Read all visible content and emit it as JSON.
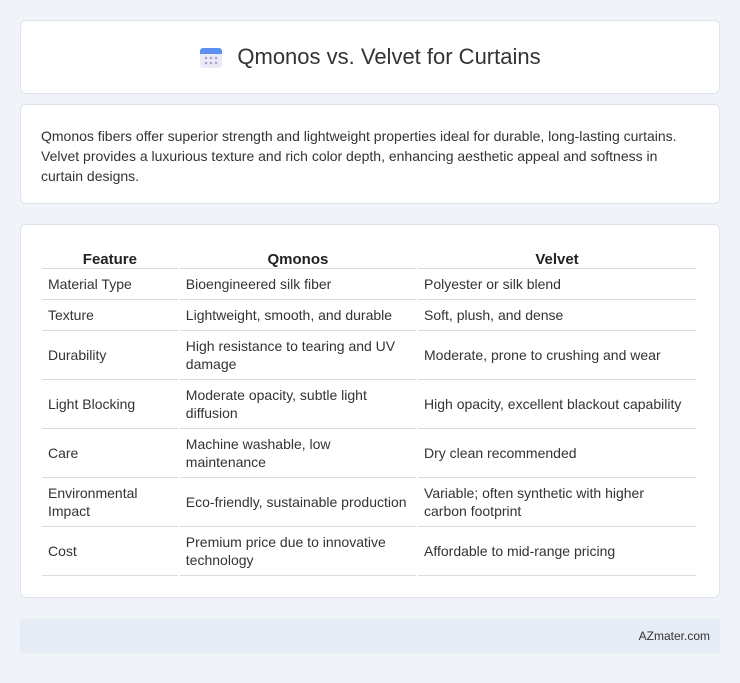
{
  "header": {
    "title": "Qmonos vs. Velvet for Curtains",
    "icon": "calendar-icon"
  },
  "intro": {
    "text": "Qmonos fibers offer superior strength and lightweight properties ideal for durable, long-lasting curtains. Velvet provides a luxurious texture and rich color depth, enhancing aesthetic appeal and softness in curtain designs."
  },
  "table": {
    "headers": [
      "Feature",
      "Qmonos",
      "Velvet"
    ],
    "rows": [
      [
        "Material Type",
        "Bioengineered silk fiber",
        "Polyester or silk blend"
      ],
      [
        "Texture",
        "Lightweight, smooth, and durable",
        "Soft, plush, and dense"
      ],
      [
        "Durability",
        "High resistance to tearing and UV damage",
        "Moderate, prone to crushing and wear"
      ],
      [
        "Light Blocking",
        "Moderate opacity, subtle light diffusion",
        "High opacity, excellent blackout capability"
      ],
      [
        "Care",
        "Machine washable, low maintenance",
        "Dry clean recommended"
      ],
      [
        "Environmental Impact",
        "Eco-friendly, sustainable production",
        "Variable; often synthetic with higher carbon footprint"
      ],
      [
        "Cost",
        "Premium price due to innovative technology",
        "Affordable to mid-range pricing"
      ]
    ]
  },
  "footer": {
    "text": "AZmater.com"
  }
}
